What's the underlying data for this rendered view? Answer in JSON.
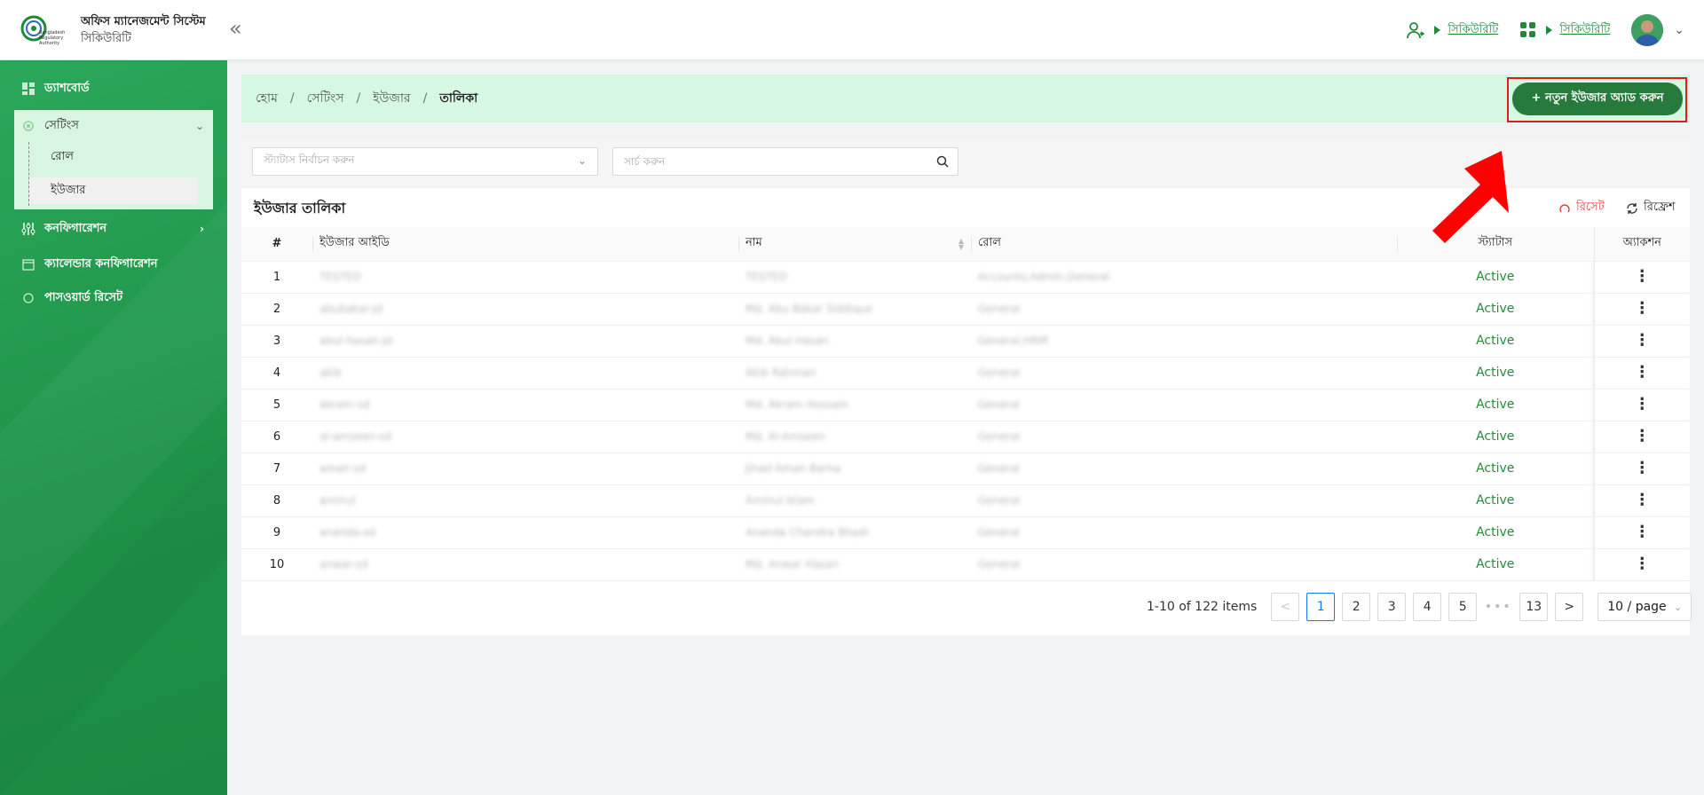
{
  "header": {
    "app_title": "অফিস ম্যানেজমেন্ট সিস্টেম",
    "app_subtitle": "সিকিউরিটি",
    "logo_text": "Bangladesh Regulatory Authority",
    "link1": "সিকিউরিটি",
    "link2": "সিকিউরিটি"
  },
  "sidebar": {
    "dashboard": "ড্যাশবোর্ড",
    "settings": "সেটিংস",
    "role": "রোল",
    "user": "ইউজার",
    "config": "কনফিগারেশন",
    "calendar_config": "ক্যালেন্ডার কনফিগারেশন",
    "password_reset": "পাসওয়ার্ড রিসেট"
  },
  "breadcrumb": {
    "home": "হোম",
    "settings": "সেটিংস",
    "user": "ইউজার",
    "current": "তালিকা",
    "sep": "/"
  },
  "add_button": "+ নতুন ইউজার অ্যাড করুন",
  "filters": {
    "status_placeholder": "স্ট্যাটাস নির্বাচন করুন",
    "search_placeholder": "সার্চ করুন"
  },
  "table": {
    "title": "ইউজার তালিকা",
    "reset": "রিসেট",
    "refresh": "রিফ্রেশ",
    "headers": {
      "num": "#",
      "user_id": "ইউজার আইডি",
      "name": "নাম",
      "role": "রোল",
      "status": "স্ট্যাটাস",
      "action": "অ্যাকশন"
    },
    "rows": [
      {
        "num": "1",
        "user_id": "TESTED",
        "name": "TESTED",
        "role": "Accounts,Admin,General",
        "status": "Active"
      },
      {
        "num": "2",
        "user_id": "abubakar-jd",
        "name": "Md. Abu Bakar Siddique",
        "role": "General",
        "status": "Active"
      },
      {
        "num": "3",
        "user_id": "abul-hasan-jd",
        "name": "Md. Abul Hasan",
        "role": "General,HRM",
        "status": "Active"
      },
      {
        "num": "4",
        "user_id": "akib",
        "name": "Akib Rahman",
        "role": "General",
        "status": "Active"
      },
      {
        "num": "5",
        "user_id": "akram-sd",
        "name": "Md. Akram Hossain",
        "role": "General",
        "status": "Active"
      },
      {
        "num": "6",
        "user_id": "al-amseen-sd",
        "name": "Md. Al-Amseen",
        "role": "General",
        "status": "Active"
      },
      {
        "num": "7",
        "user_id": "aman-sd",
        "name": "Jihad Aman Barna",
        "role": "General",
        "status": "Active"
      },
      {
        "num": "8",
        "user_id": "aminul",
        "name": "Aminul Islam",
        "role": "General",
        "status": "Active"
      },
      {
        "num": "9",
        "user_id": "ananda-sd",
        "name": "Ananda Chandra Bhadi",
        "role": "General",
        "status": "Active"
      },
      {
        "num": "10",
        "user_id": "anwar-sd",
        "name": "Md. Anwar Hasan",
        "role": "General",
        "status": "Active"
      }
    ],
    "action_icon": "⋮"
  },
  "pagination": {
    "total": "1-10 of 122 items",
    "prev": "<",
    "next": ">",
    "pages": [
      "1",
      "2",
      "3",
      "4",
      "5"
    ],
    "ellipsis": "•••",
    "last": "13",
    "page_size": "10 / page"
  },
  "colors": {
    "primary": "#257a3c",
    "sidebar": "#1e9147",
    "accent_light": "#d6f7e2",
    "highlight": "#e01b1b"
  }
}
